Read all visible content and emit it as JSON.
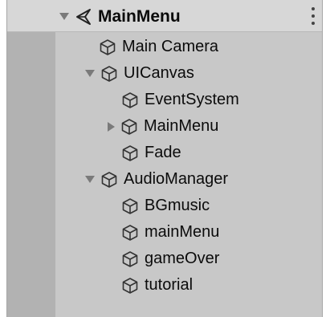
{
  "hierarchy": {
    "scene": {
      "label": "MainMenu",
      "icon": "unity-scene-icon",
      "expanded": true
    },
    "menu_icon": "kebab-menu-icon",
    "items": [
      {
        "label": "Main Camera",
        "icon": "gameobject-cube-icon",
        "depth": 1,
        "has_children": false
      },
      {
        "label": "UICanvas",
        "icon": "gameobject-cube-icon",
        "depth": 1,
        "has_children": true,
        "expanded": true
      },
      {
        "label": "EventSystem",
        "icon": "gameobject-cube-icon",
        "depth": 2,
        "has_children": false
      },
      {
        "label": "MainMenu",
        "icon": "gameobject-cube-icon",
        "depth": 2,
        "has_children": true,
        "expanded": false
      },
      {
        "label": "Fade",
        "icon": "gameobject-cube-icon",
        "depth": 2,
        "has_children": false
      },
      {
        "label": "AudioManager",
        "icon": "gameobject-cube-icon",
        "depth": 1,
        "has_children": true,
        "expanded": true
      },
      {
        "label": "BGmusic",
        "icon": "gameobject-cube-icon",
        "depth": 2,
        "has_children": false
      },
      {
        "label": "mainMenu",
        "icon": "gameobject-cube-icon",
        "depth": 2,
        "has_children": false
      },
      {
        "label": "gameOver",
        "icon": "gameobject-cube-icon",
        "depth": 2,
        "has_children": false
      },
      {
        "label": "tutorial",
        "icon": "gameobject-cube-icon",
        "depth": 2,
        "has_children": false
      }
    ]
  }
}
